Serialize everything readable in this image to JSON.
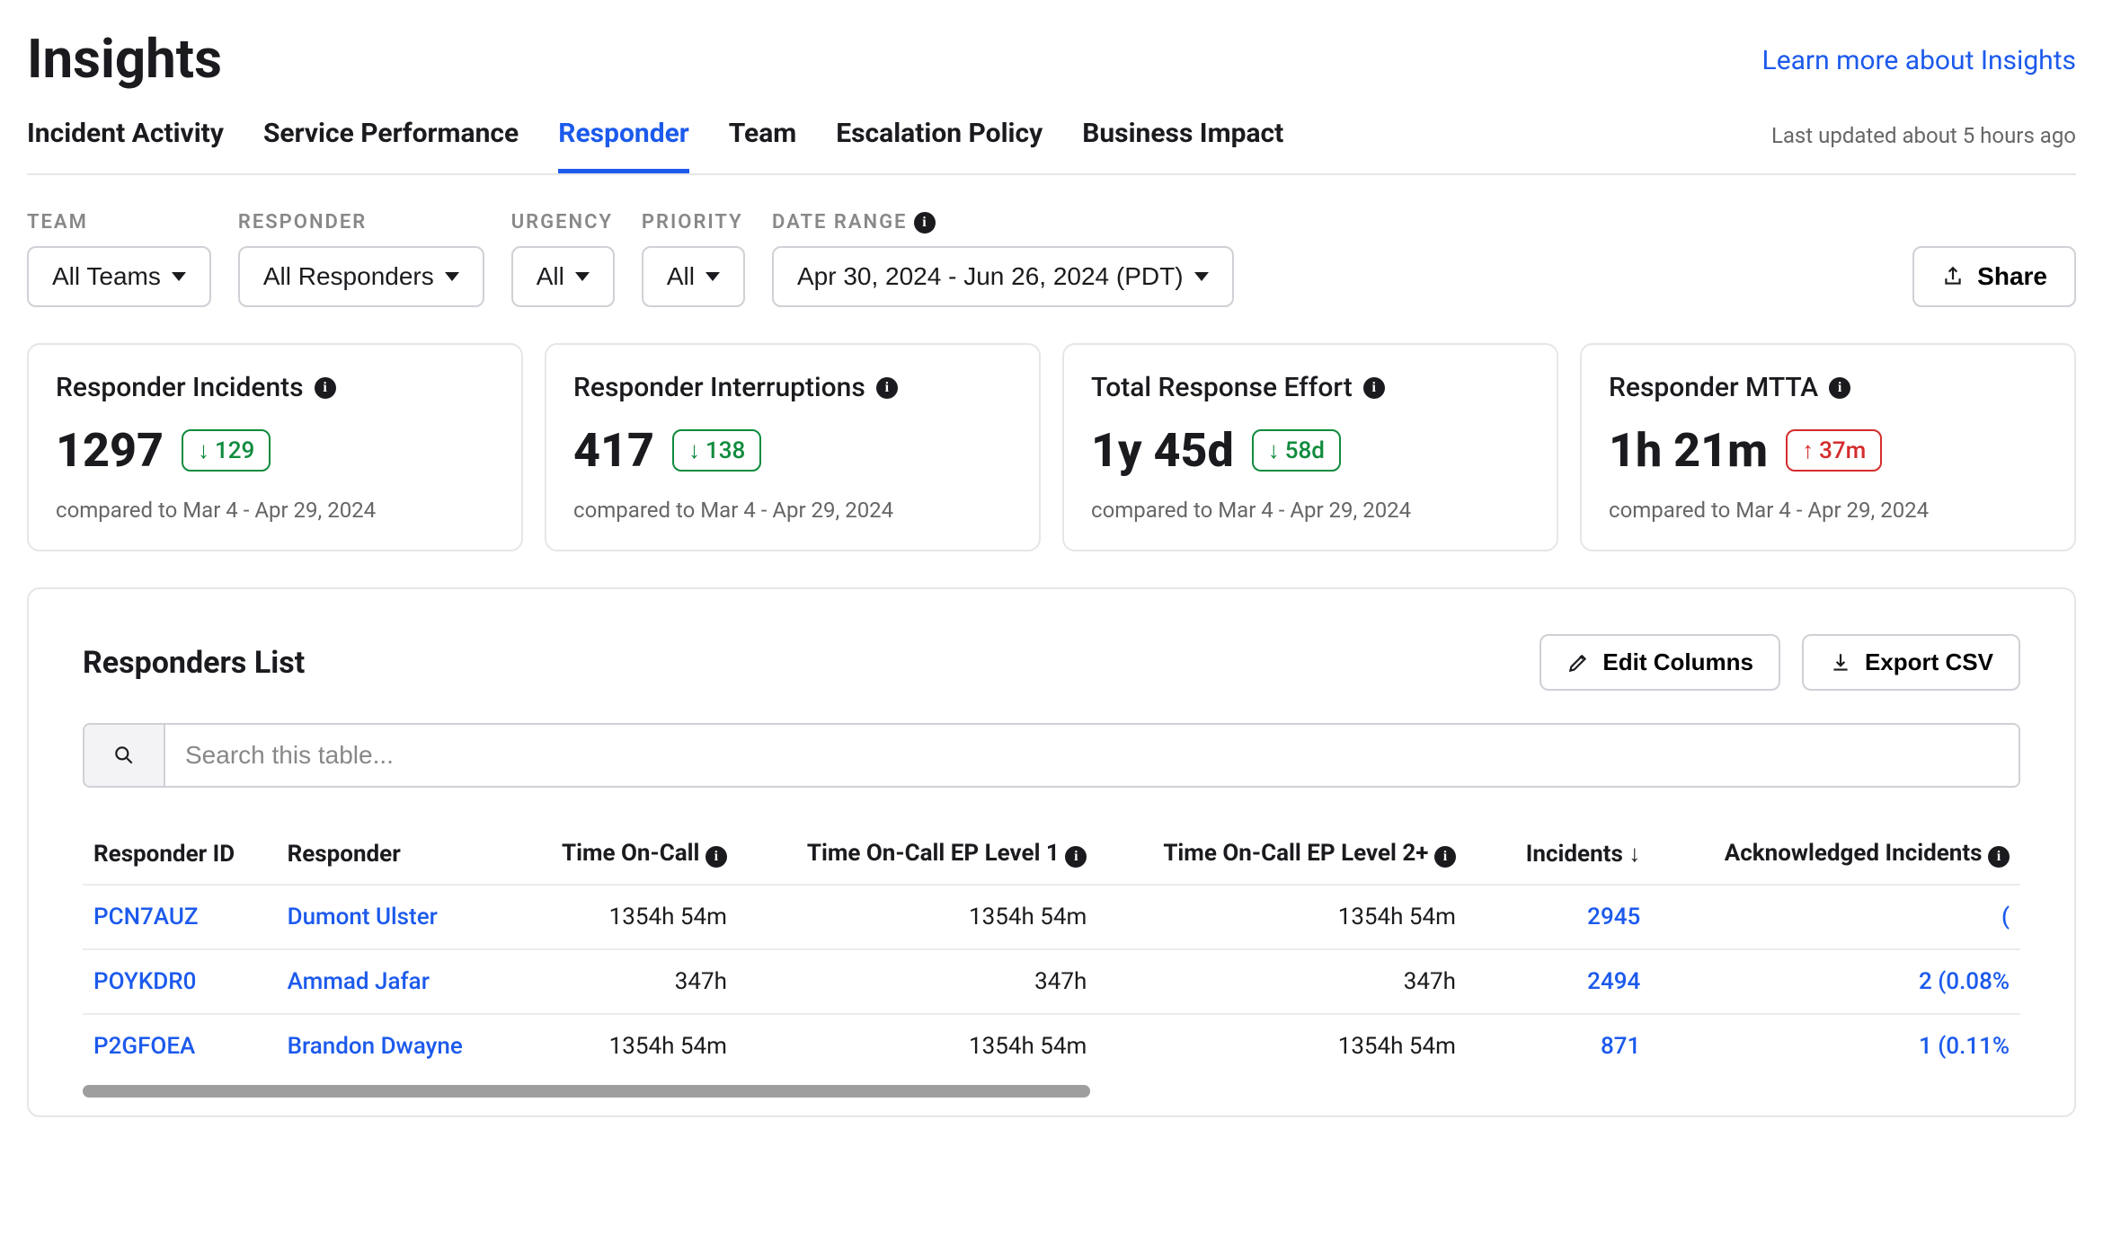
{
  "header": {
    "title": "Insights",
    "learn_link": "Learn more about Insights",
    "last_updated": "Last updated about 5 hours ago"
  },
  "tabs": [
    {
      "label": "Incident Activity",
      "active": false
    },
    {
      "label": "Service Performance",
      "active": false
    },
    {
      "label": "Responder",
      "active": true
    },
    {
      "label": "Team",
      "active": false
    },
    {
      "label": "Escalation Policy",
      "active": false
    },
    {
      "label": "Business Impact",
      "active": false
    }
  ],
  "filters": {
    "team": {
      "label": "TEAM",
      "value": "All Teams"
    },
    "responder": {
      "label": "RESPONDER",
      "value": "All Responders"
    },
    "urgency": {
      "label": "URGENCY",
      "value": "All"
    },
    "priority": {
      "label": "PRIORITY",
      "value": "All"
    },
    "date_range": {
      "label": "DATE RANGE",
      "value": "Apr 30, 2024 - Jun 26, 2024 (PDT)"
    },
    "share_label": "Share"
  },
  "stats": {
    "compare_label": "compared to Mar 4 - Apr 29, 2024",
    "cards": [
      {
        "title": "Responder Incidents",
        "value": "1297",
        "delta": "129",
        "direction": "down"
      },
      {
        "title": "Responder Interruptions",
        "value": "417",
        "delta": "138",
        "direction": "down"
      },
      {
        "title": "Total Response Effort",
        "value": "1y 45d",
        "delta": "58d",
        "direction": "down"
      },
      {
        "title": "Responder MTTA",
        "value": "1h 21m",
        "delta": "37m",
        "direction": "up"
      }
    ]
  },
  "panel": {
    "title": "Responders List",
    "edit_columns": "Edit Columns",
    "export_csv": "Export CSV",
    "search_placeholder": "Search this table...",
    "columns": [
      {
        "label": "Responder ID",
        "align": "left"
      },
      {
        "label": "Responder",
        "align": "left"
      },
      {
        "label": "Time On-Call",
        "align": "right",
        "info": true
      },
      {
        "label": "Time On-Call EP Level 1",
        "align": "right",
        "info": true
      },
      {
        "label": "Time On-Call EP Level 2+",
        "align": "right",
        "info": true
      },
      {
        "label": "Incidents",
        "align": "right",
        "sort": true
      },
      {
        "label": "Acknowledged Incidents",
        "align": "right",
        "info": true
      }
    ],
    "rows": [
      {
        "id": "PCN7AUZ",
        "responder": "Dumont Ulster",
        "on_call": "1354h 54m",
        "l1": "1354h 54m",
        "l2": "1354h 54m",
        "incidents": "2945",
        "ack": "("
      },
      {
        "id": "POYKDR0",
        "responder": "Ammad Jafar",
        "on_call": "347h",
        "l1": "347h",
        "l2": "347h",
        "incidents": "2494",
        "ack": "2 (0.08%"
      },
      {
        "id": "P2GFOEA",
        "responder": "Brandon Dwayne",
        "on_call": "1354h 54m",
        "l1": "1354h 54m",
        "l2": "1354h 54m",
        "incidents": "871",
        "ack": "1 (0.11%"
      }
    ]
  }
}
